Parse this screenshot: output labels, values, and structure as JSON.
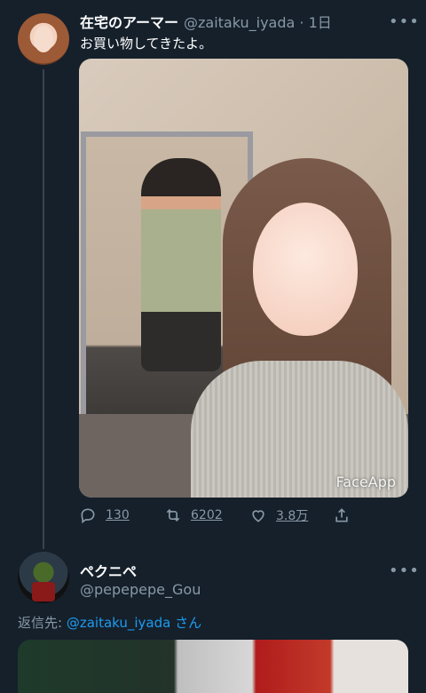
{
  "tweet": {
    "name": "在宅のアーマー",
    "handle": "@zaitaku_iyada",
    "time": "· 1日",
    "text": "お買い物してきたよ。",
    "image_watermark": "FaceApp",
    "actions": {
      "reply_count": "130",
      "retweet_count": "6202",
      "like_count": "3.8万"
    },
    "more_label": "•••"
  },
  "reply": {
    "name": "ペクニペ",
    "handle": "@pepepepe_Gou",
    "more_label": "•••",
    "reply_to_label": "返信先:",
    "reply_to_handle": "@zaitaku_iyada",
    "reply_to_suffix": "さん"
  },
  "colors": {
    "background": "#15202b",
    "secondary_text": "#8899a6",
    "link": "#1d9bf0"
  },
  "icons": [
    "reply-icon",
    "retweet-icon",
    "like-icon",
    "share-icon"
  ]
}
